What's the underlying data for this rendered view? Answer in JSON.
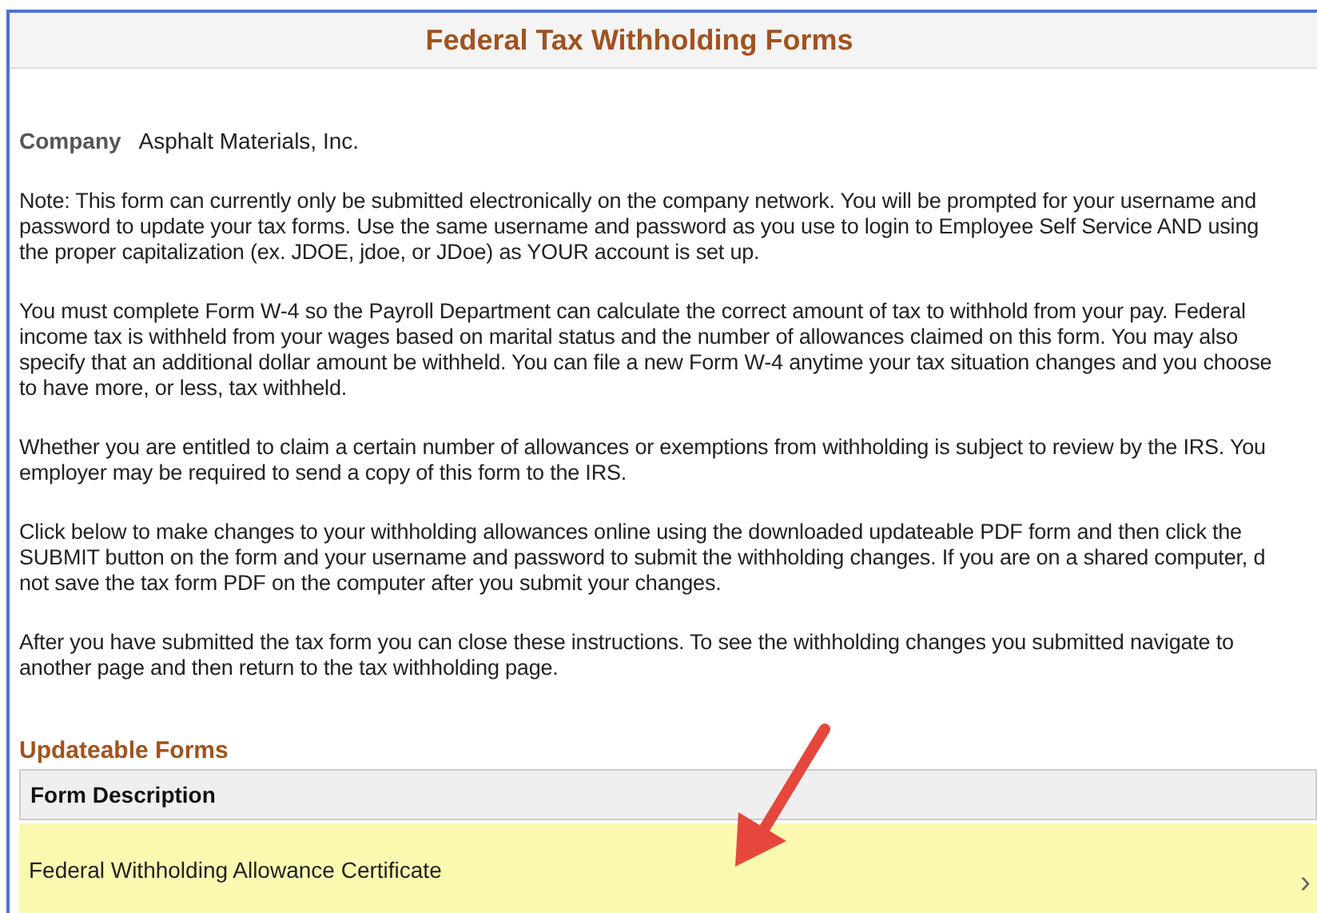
{
  "title": "Federal Tax Withholding Forms",
  "company": {
    "label": "Company",
    "value": "Asphalt Materials, Inc."
  },
  "paragraphs": [
    {
      "lines": [
        "Note: This form can currently only be submitted electronically on the company network. You will be prompted for your username and",
        "password to update your tax forms. Use the same username and password as you use to login to Employee Self Service AND using",
        "the proper capitalization (ex. JDOE, jdoe, or JDoe) as YOUR account is set up."
      ]
    },
    {
      "lines": [
        "You must complete Form W-4 so the Payroll Department can calculate the correct amount of tax to withhold from your pay. Federal",
        "income tax is withheld from your wages based on marital status and the number of allowances claimed on this form. You may also",
        "specify that an additional dollar amount be withheld. You can file a new Form W-4 anytime your tax situation changes and you choose",
        "to have more, or less, tax withheld."
      ]
    },
    {
      "lines": [
        "Whether you are entitled to claim a certain number of allowances or exemptions from withholding is subject to review by the IRS. You",
        "employer may be required to send a copy of this form to the IRS."
      ]
    },
    {
      "lines": [
        "Click below to make changes to your withholding allowances online using the downloaded updateable PDF form and then click the",
        "SUBMIT button on the form and your username and password to submit the withholding changes. If you are on a shared computer, d",
        "not save the tax form PDF on the computer after you submit your changes."
      ]
    },
    {
      "lines": [
        "After you have submitted the tax form you can close these instructions. To see the withholding changes you submitted navigate to",
        "another page and then return to the tax withholding page."
      ]
    }
  ],
  "section": {
    "title": "Updateable Forms",
    "columns": [
      "Form Description"
    ],
    "rows": [
      {
        "description": "Federal Withholding Allowance Certificate",
        "selected": true,
        "chevron": "›"
      }
    ]
  }
}
